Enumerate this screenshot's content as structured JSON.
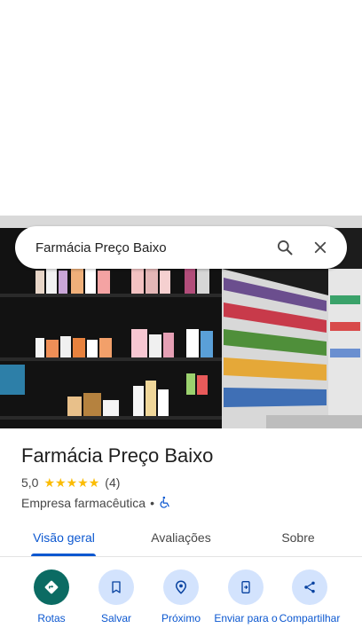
{
  "search": {
    "query": "Farmácia Preço Baixo",
    "search_icon": "search-icon",
    "close_icon": "close-icon"
  },
  "place": {
    "title": "Farmácia Preço Baixo",
    "rating": "5,0",
    "stars": 5,
    "review_count": "(4)",
    "category": "Empresa farmacêutica",
    "separator": "•",
    "accessibility_icon": "wheelchair-icon"
  },
  "tabs": [
    {
      "label": "Visão geral",
      "active": true
    },
    {
      "label": "Avaliações",
      "active": false
    },
    {
      "label": "Sobre",
      "active": false
    }
  ],
  "actions": [
    {
      "label": "Rotas",
      "icon": "directions-icon"
    },
    {
      "label": "Salvar",
      "icon": "bookmark-icon"
    },
    {
      "label": "Próximo",
      "icon": "nearby-icon"
    },
    {
      "label": "Enviar para o",
      "icon": "send-to-phone-icon"
    },
    {
      "label": "Compartilhar",
      "icon": "share-icon"
    }
  ],
  "colors": {
    "accent": "#0b57d0",
    "star": "#fbbc04",
    "primary_action": "#0b6b63",
    "action_bg": "#d3e3fd"
  }
}
